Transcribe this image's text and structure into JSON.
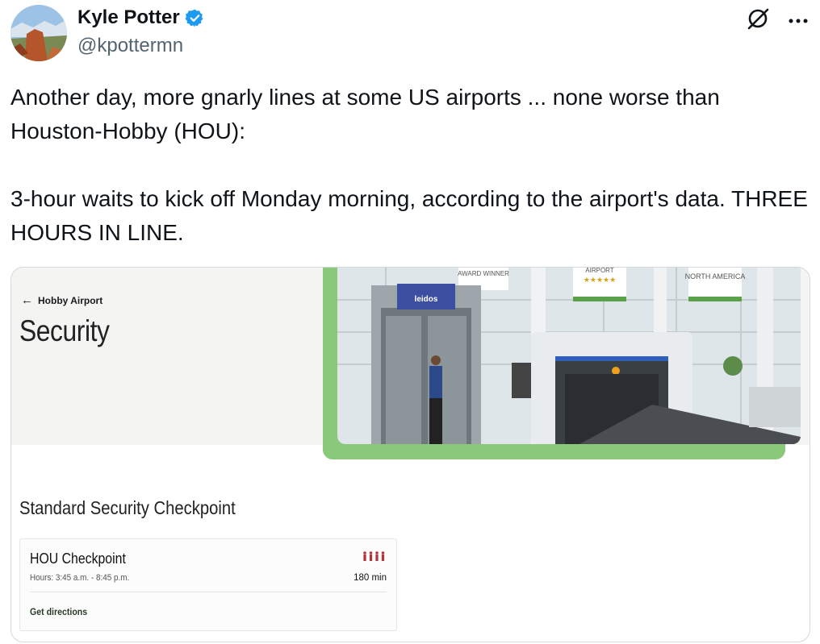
{
  "author": {
    "display_name": "Kyle Potter",
    "handle": "@kpottermn",
    "avatar_icon": "avatar-photo"
  },
  "tweet": {
    "text": "Another day, more gnarly lines at some US airports ... none worse than Houston-Hobby (HOU):\n\n3-hour waits to kick off Monday morning, according to the airport's data. THREE HOURS IN LINE."
  },
  "media": {
    "back_label": "Hobby Airport",
    "page_title": "Security",
    "photo_signs": [
      "AWARD WINNER",
      "AIRPORT",
      "NORTH AMERICA",
      "leidos"
    ],
    "section_title": "Standard Security Checkpoint",
    "checkpoint": {
      "name": "HOU Checkpoint",
      "hours": "Hours: 3:45 a.m. - 8:45 p.m.",
      "wait": "180 min",
      "directions_label": "Get directions"
    }
  },
  "colors": {
    "verified": "#1d9bf0",
    "green_band": "#8bc97a",
    "wait_icon": "#b5323c"
  }
}
